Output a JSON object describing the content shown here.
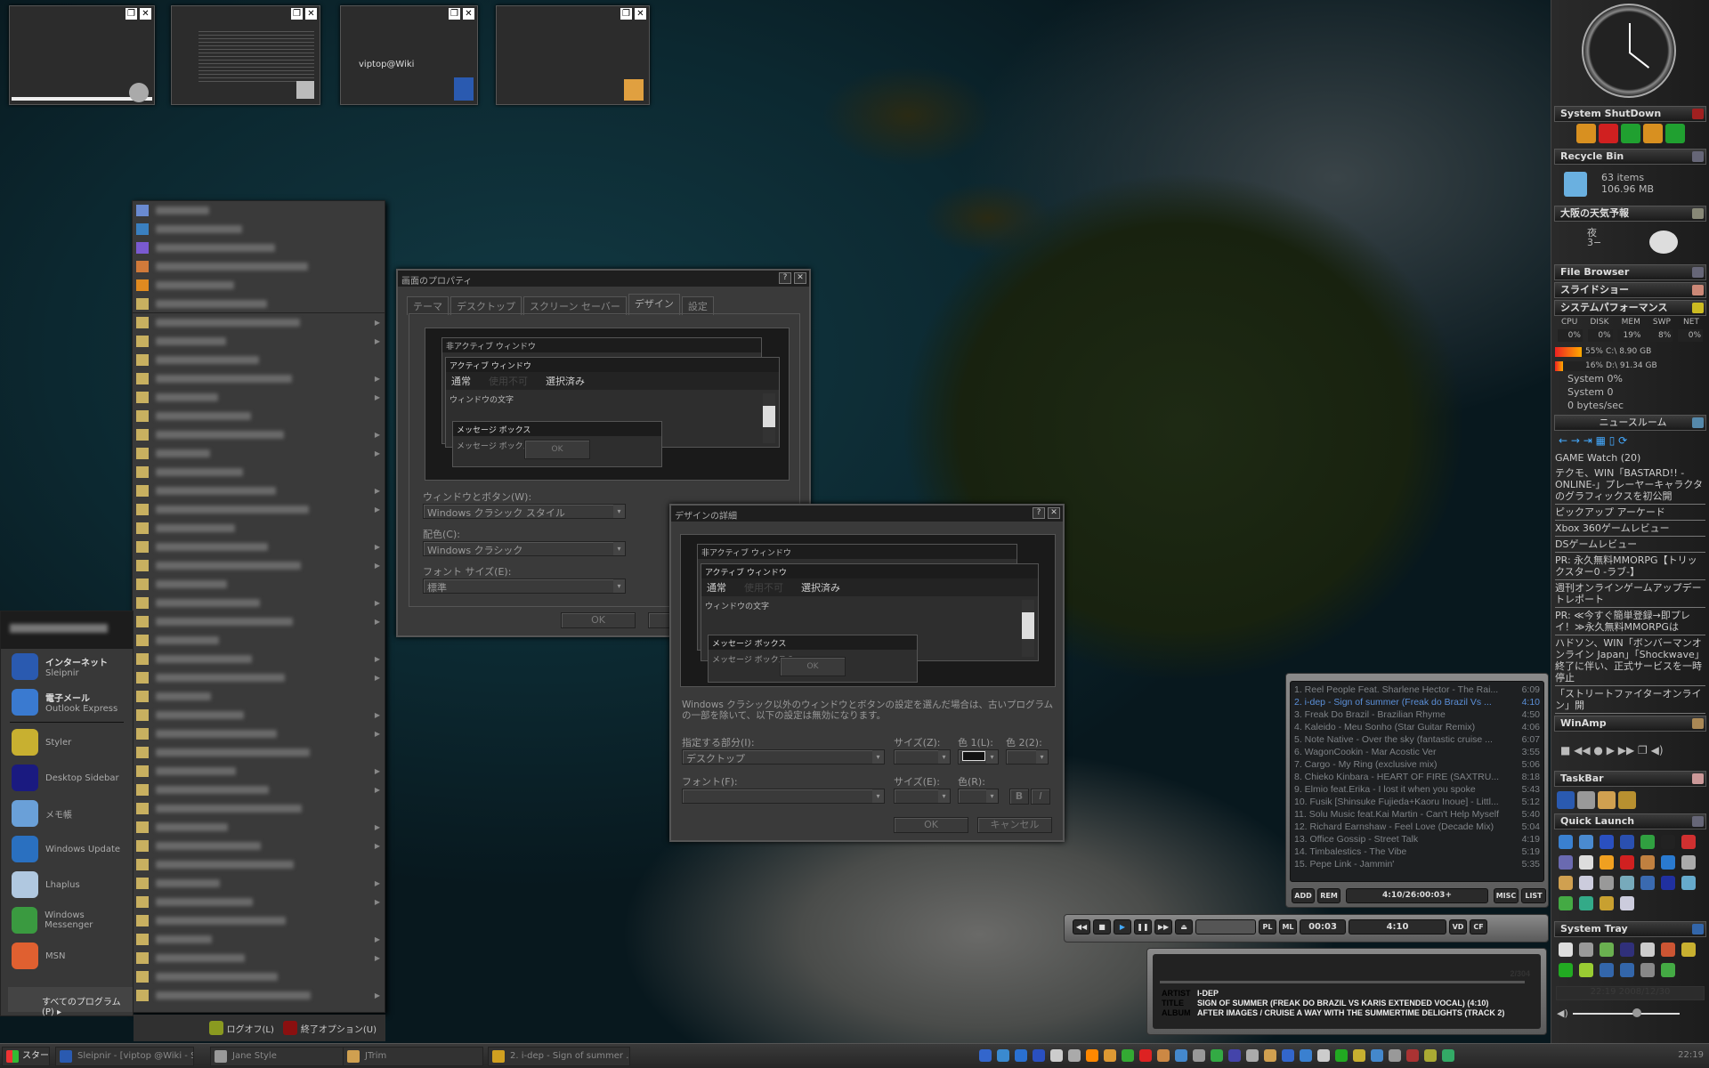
{
  "thumbnails": [
    {
      "name": "window-1"
    },
    {
      "name": "window-2"
    },
    {
      "name": "window-3",
      "text": "viptop@Wiki"
    },
    {
      "name": "window-4"
    }
  ],
  "sidebar": {
    "shutdown": {
      "title": "System ShutDown"
    },
    "recycle": {
      "title": "Recycle Bin",
      "items": "63 items",
      "size": "106.96 MB"
    },
    "weather": {
      "title": "大阪の天気予報",
      "period": "夜",
      "temp": "3−"
    },
    "file_browser": {
      "title": "File Browser"
    },
    "slideshow": {
      "title": "スライドショー"
    },
    "perf": {
      "title": "システムパフォーマンス",
      "headers": [
        "CPU",
        "DISK",
        "MEM",
        "SWP",
        "NET"
      ],
      "values": [
        "0%",
        "0%",
        "19%",
        "8%",
        "0%"
      ],
      "drives": [
        {
          "pct": "55%",
          "label": "C:\\ 8.90 GB",
          "fill": 55
        },
        {
          "pct": "16%",
          "label": "D:\\ 91.34 GB",
          "fill": 16
        }
      ],
      "system_cpu": "System 0%",
      "system_disk": "System 0",
      "net": "0 bytes/sec"
    },
    "news": {
      "title": "ニュースルーム",
      "feed": "GAME Watch (20)",
      "items": [
        "テクモ、WIN「BASTARD!! -ONLINE-」プレーヤーキャラクタのグラフィックスを初公開",
        "ピックアップ アーケード",
        "Xbox 360ゲームレビュー",
        "DSゲームレビュー",
        "PR: 永久無料MMORPG【トリックスター0 -ラブ-】",
        "週刊オンラインゲームアップデートレポート",
        "PR: ≪今すぐ簡単登録→即プレイ！≫永久無料MMORPGは",
        "ハドソン、WIN「ボンバーマンオンライン Japan」「Shockwave」終了に伴い、正式サービスを一時停止",
        "「ストリートファイターオンライン」開"
      ]
    },
    "winamp": {
      "title": "WinAmp"
    },
    "taskbar": {
      "title": "TaskBar"
    },
    "quick_launch": {
      "title": "Quick Launch"
    },
    "system_tray": {
      "title": "System Tray",
      "datetime": "22:19 2008/12/30",
      "volume": 0.6
    }
  },
  "start_menu": {
    "pinned": [
      {
        "title": "インターネット",
        "sub": "Sleipnir",
        "color": "#2a5ab0"
      },
      {
        "title": "電子メール",
        "sub": "Outlook Express",
        "color": "#3a7ad0"
      }
    ],
    "recent": [
      {
        "label": "Styler",
        "color": "#c8b030"
      },
      {
        "label": "Desktop Sidebar",
        "color": "#1a1a80"
      },
      {
        "label": "メモ帳",
        "color": "#6aa0d8"
      },
      {
        "label": "Windows Update",
        "color": "#2a70c0"
      },
      {
        "label": "Lhaplus",
        "color": "#b0c8e0"
      },
      {
        "label": "Windows Messenger",
        "color": "#3a9a40"
      },
      {
        "label": "MSN",
        "color": "#e06030"
      }
    ],
    "all_programs": "すべてのプログラム(P)",
    "logoff": "ログオフ(L)",
    "shutdown": "終了オプション(U)"
  },
  "display_props": {
    "title": "画面のプロパティ",
    "tabs": [
      "テーマ",
      "デスクトップ",
      "スクリーン セーバー",
      "デザイン",
      "設定"
    ],
    "active_tab": "デザイン",
    "preview": {
      "inactive": "非アクティブ ウィンドウ",
      "active": "アクティブ ウィンドウ",
      "menu": [
        "通常",
        "使用不可",
        "選択済み"
      ],
      "window_text": "ウィンドウの文字",
      "msgbox": "メッセージ ボックス",
      "msg_text": "メッセージ ボックスの",
      "ok": "OK"
    },
    "windows_buttons_label": "ウィンドウとボタン(W):",
    "windows_buttons_value": "Windows クラシック スタイル",
    "color_scheme_label": "配色(C):",
    "color_scheme_value": "Windows クラシック",
    "font_size_label": "フォント サイズ(E):",
    "font_size_value": "標準",
    "ok": "OK",
    "cancel": "キ"
  },
  "design_detail": {
    "title": "デザインの詳細",
    "note": "Windows クラシック以外のウィンドウとボタンの設定を選んだ場合は、古いプログラムの一部を除いて、以下の設定は無効になります。",
    "item_label": "指定する部分(I):",
    "item_value": "デスクトップ",
    "size_label": "サイズ(Z):",
    "color1_label": "色 1(L):",
    "color2_label": "色 2(2):",
    "font_label": "フォント(F):",
    "font_size_label": "サイズ(E):",
    "font_color_label": "色(R):",
    "bold": "B",
    "italic": "I",
    "ok": "OK",
    "cancel": "キャンセル"
  },
  "winamp": {
    "playlist": [
      {
        "title": "1. Reel People Feat. Sharlene Hector - The Rai...",
        "time": "6:09"
      },
      {
        "title": "2. i-dep - Sign of summer (Freak do Brazil Vs ...",
        "time": "4:10",
        "current": true
      },
      {
        "title": "3. Freak Do Brazil - Brazilian Rhyme",
        "time": "4:50"
      },
      {
        "title": "4. Kaleido - Meu Sonho (Star Guitar Remix)",
        "time": "4:06"
      },
      {
        "title": "5. Note Native - Over the sky (fantastic cruise ...",
        "time": "6:07"
      },
      {
        "title": "6. WagonCookin - Mar Acostic Ver",
        "time": "3:55"
      },
      {
        "title": "7. Cargo - My Ring (exclusive mix)",
        "time": "5:06"
      },
      {
        "title": "8. Chieko Kinbara - HEART OF FIRE (SAXTRU...",
        "time": "8:18"
      },
      {
        "title": "9. Elmio feat.Erika - I lost it when you spoke",
        "time": "5:43"
      },
      {
        "title": "10. Fusik [Shinsuke Fujieda+Kaoru Inoue] - Littl...",
        "time": "5:12"
      },
      {
        "title": "11. Solu Music feat.Kai Martin - Can't Help Myself",
        "time": "5:40"
      },
      {
        "title": "12. Richard Earnshaw - Feel Love (Decade Mix)",
        "time": "5:04"
      },
      {
        "title": "13. Office Gossip - Street Talk",
        "time": "4:19"
      },
      {
        "title": "14. Timbalestics - The Vibe",
        "time": "5:19"
      },
      {
        "title": "15. Pepe Link - Jammin'",
        "time": "5:35"
      }
    ],
    "add": "ADD",
    "rem": "REM",
    "total": "4:10/26:00:03+",
    "misc": "MISC",
    "list": "LIST",
    "pl": "PL",
    "ml": "ML",
    "elapsed": "00:03",
    "length": "4:10",
    "vd": "VD",
    "cf": "CF",
    "info": {
      "position": "2/304",
      "artist_label": "ARTIST",
      "artist": "I-DEP",
      "title_label": "TITLE",
      "title": "SIGN OF SUMMER (FREAK DO BRAZIL VS KARIS EXTENDED VOCAL) (4:10)",
      "album_label": "ALBUM",
      "album": "AFTER IMAGES / CRUISE A WAY WITH THE SUMMERTIME DELIGHTS (TRACK 2)"
    }
  },
  "taskbar": {
    "start": "スタート",
    "buttons": [
      {
        "label": "Sleipnir - [viptop @Wiki - St...",
        "color": "#2a5ab0"
      },
      {
        "label": "Jane Style",
        "color": "#999"
      },
      {
        "label": "JTrim",
        "color": "#d0a050"
      },
      {
        "label": "2. i-dep - Sign of summer ...",
        "color": "#d0a020"
      }
    ],
    "clock": "22:19"
  }
}
